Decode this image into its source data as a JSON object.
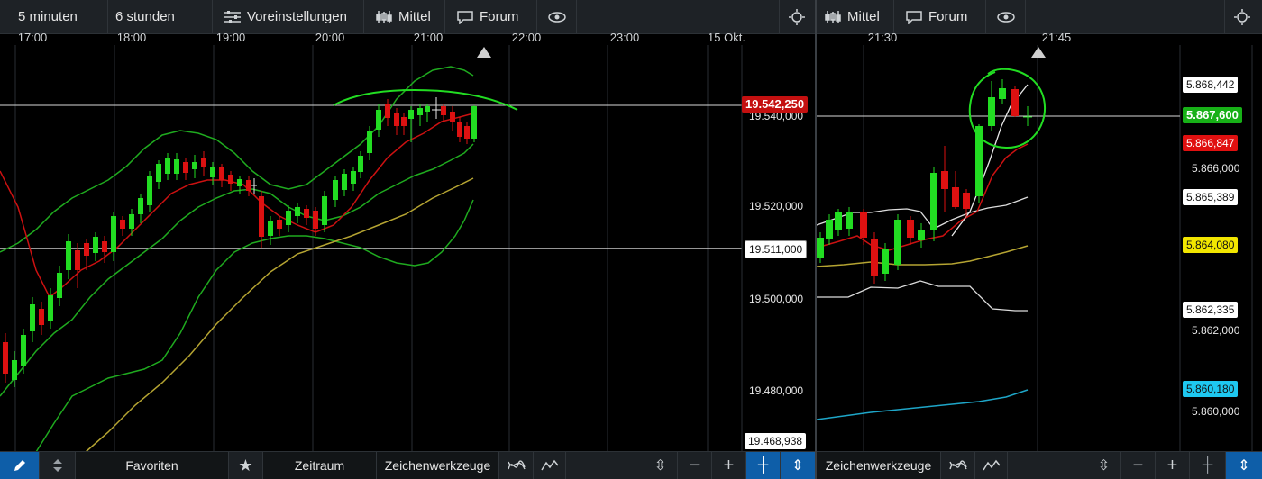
{
  "left": {
    "toolbar": {
      "interval": "5 minuten",
      "range": "6 stunden",
      "presets": "Voreinstellungen",
      "price_type": "Mittel",
      "forum": "Forum"
    },
    "time_labels": [
      "17:00",
      "18:00",
      "19:00",
      "20:00",
      "21:00",
      "22:00",
      "23:00",
      "15 Okt."
    ],
    "price_labels": [
      "19.540,000",
      "19.520,000",
      "19.500,000",
      "19.480,000"
    ],
    "tags": {
      "current": "19.542,250",
      "line": "19.511,000",
      "bottom": "19.468,938"
    },
    "bottombar": {
      "favorites": "Favoriten",
      "timeframe": "Zeitraum",
      "drawing": "Zeichenwerkzeuge"
    }
  },
  "right": {
    "toolbar": {
      "price_type": "Mittel",
      "forum": "Forum"
    },
    "time_labels": [
      "21:30",
      "21:45"
    ],
    "price_labels": [
      "5.866,000",
      "5.862,000",
      "5.860,000"
    ],
    "tags": {
      "t1": "5.868,442",
      "current": "5.867,600",
      "t3": "5.866,847",
      "t4": "5.865,389",
      "t5": "5.864,080",
      "t6": "5.862,335",
      "t7": "5.860,180"
    },
    "bottombar": {
      "drawing": "Zeichenwerkzeuge"
    }
  },
  "colors": {
    "up": "#22dd22",
    "down": "#dd1111",
    "bollinger": "#1faa1f",
    "ma_red": "#cc1111",
    "ma_yellow": "#b5a432",
    "accent_blue": "#0e5ea8",
    "current_tag_red": "#c41010",
    "current_tag_green": "#17b017",
    "tag_yellow": "#f2e600",
    "tag_cyan": "#1ec8f0"
  }
}
